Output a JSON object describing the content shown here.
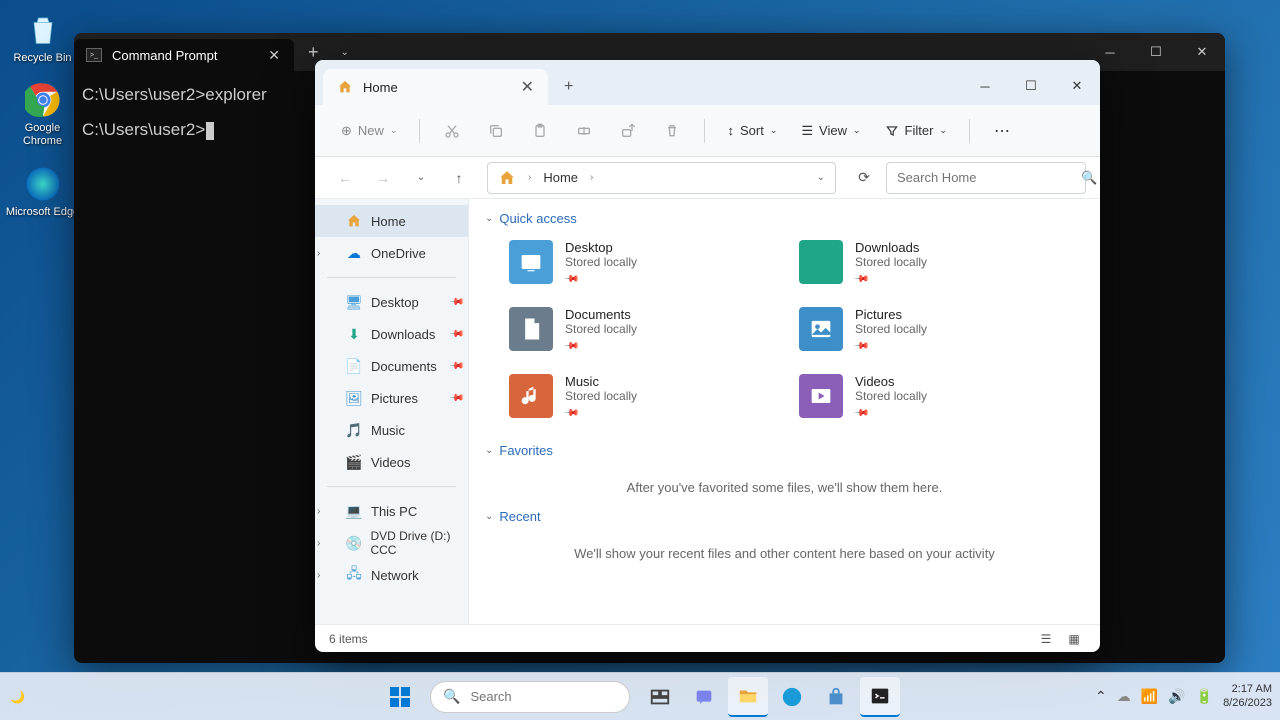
{
  "desktop": {
    "icons": [
      {
        "label": "Recycle Bin"
      },
      {
        "label": "Google Chrome"
      },
      {
        "label": "Microsoft Edge"
      }
    ]
  },
  "cmd": {
    "tab_title": "Command Prompt",
    "line1": "C:\\Users\\user2>explorer",
    "line2": "C:\\Users\\user2>"
  },
  "explorer": {
    "tab_title": "Home",
    "toolbar": {
      "new": "New",
      "sort": "Sort",
      "view": "View",
      "filter": "Filter"
    },
    "address": {
      "location": "Home"
    },
    "search_placeholder": "Search Home",
    "sidebar": {
      "home": "Home",
      "onedrive": "OneDrive",
      "desktop": "Desktop",
      "downloads": "Downloads",
      "documents": "Documents",
      "pictures": "Pictures",
      "music": "Music",
      "videos": "Videos",
      "thispc": "This PC",
      "dvd": "DVD Drive (D:) CCC",
      "network": "Network"
    },
    "sections": {
      "quick": "Quick access",
      "favorites": "Favorites",
      "recent": "Recent"
    },
    "quick_items": [
      {
        "name": "Desktop",
        "loc": "Stored locally",
        "color": "#4a9fd8"
      },
      {
        "name": "Downloads",
        "loc": "Stored locally",
        "color": "#1fa588"
      },
      {
        "name": "Documents",
        "loc": "Stored locally",
        "color": "#6b7c8d"
      },
      {
        "name": "Pictures",
        "loc": "Stored locally",
        "color": "#3d8fc9"
      },
      {
        "name": "Music",
        "loc": "Stored locally",
        "color": "#d8663d"
      },
      {
        "name": "Videos",
        "loc": "Stored locally",
        "color": "#8b5fb8"
      }
    ],
    "favorites_empty": "After you've favorited some files, we'll show them here.",
    "recent_empty": "We'll show your recent files and other content here based on your activity",
    "status": "6 items"
  },
  "taskbar": {
    "search_placeholder": "Search",
    "time": "2:17 AM",
    "date": "8/26/2023"
  }
}
